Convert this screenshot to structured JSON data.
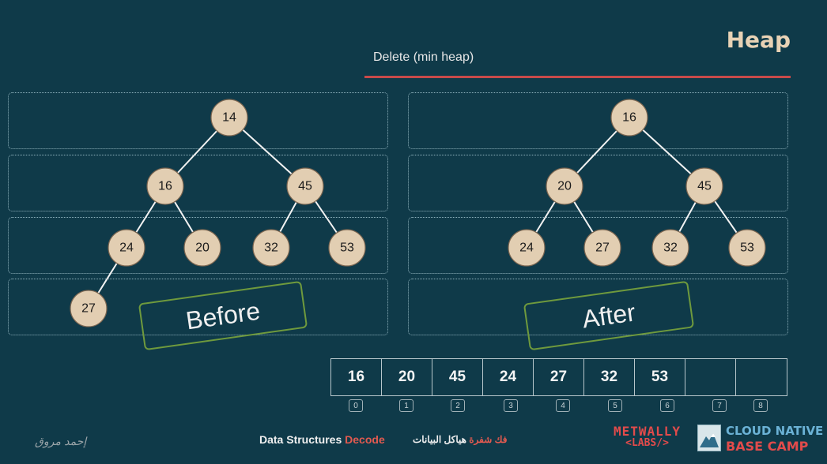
{
  "header": {
    "title": "Heap",
    "subtitle": "Delete (min heap)"
  },
  "before_tree": {
    "label": "Before",
    "nodes": [
      14,
      16,
      45,
      24,
      20,
      32,
      53,
      27
    ]
  },
  "after_tree": {
    "label": "After",
    "nodes": [
      16,
      20,
      45,
      24,
      27,
      32,
      53
    ]
  },
  "array": {
    "cells": [
      "16",
      "20",
      "45",
      "24",
      "27",
      "32",
      "53",
      "",
      ""
    ],
    "indices": [
      "0",
      "1",
      "2",
      "3",
      "4",
      "5",
      "6",
      "7",
      "8"
    ]
  },
  "footer": {
    "signature": "إحمد مروق",
    "brand_main": "Data Structures",
    "brand_accent": "Decode",
    "arabic_accent": "فك شفرة",
    "arabic_main": "هياكل البيانات"
  },
  "logos": {
    "metwally_line1": "METWALLY",
    "metwally_line2": "<LABS/>",
    "cloud_line1": "CLOUD NATIVE",
    "cloud_line2": "BASE CAMP"
  },
  "colors": {
    "background": "#0f3a49",
    "node_fill": "#e2ceb2",
    "accent_red": "#c84a4a",
    "stamp_green": "#6f9a3d"
  }
}
